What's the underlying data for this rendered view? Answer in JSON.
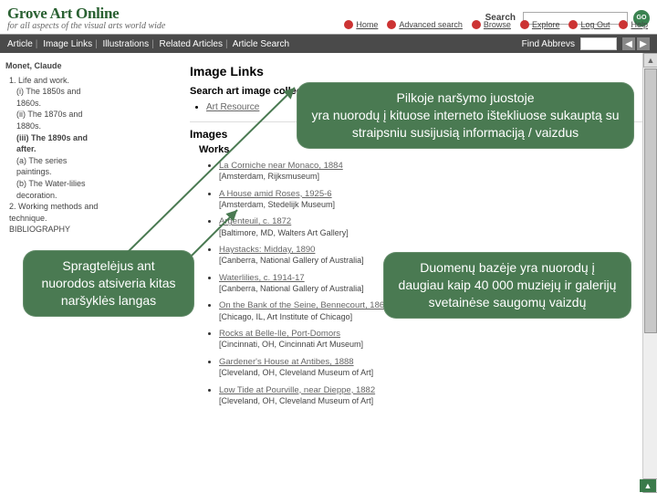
{
  "header": {
    "brand_title": "Grove Art Online",
    "brand_tag": "for all aspects of the visual arts world wide",
    "search_label": "Search",
    "go_label": "GO"
  },
  "navlinks": [
    {
      "label": "Home"
    },
    {
      "label": "Advanced search"
    },
    {
      "label": "Browse"
    },
    {
      "label": "Explore"
    },
    {
      "label": "Log Out"
    },
    {
      "label": "Help"
    }
  ],
  "greybar": {
    "tabs": [
      "Article",
      "Image Links",
      "Illustrations",
      "Related Articles",
      "Article Search"
    ],
    "find_label": "Find Abbrevs"
  },
  "sidebar": {
    "artist": "Monet, Claude",
    "toc": [
      {
        "t": "1. Life and work.",
        "cls": "toc-item"
      },
      {
        "t": "(i) The 1850s and 1860s.",
        "cls": "toc-sub"
      },
      {
        "t": "(ii) The 1870s and 1880s.",
        "cls": "toc-sub"
      },
      {
        "t": "(iii) The 1890s and after.",
        "cls": "toc-sub bold"
      },
      {
        "t": "(a) The series paintings.",
        "cls": "toc-sub"
      },
      {
        "t": "(b) The Water-lilies decoration.",
        "cls": "toc-sub"
      },
      {
        "t": "2. Working methods and technique.",
        "cls": "toc-item"
      },
      {
        "t": "BIBLIOGRAPHY",
        "cls": "toc-item"
      }
    ]
  },
  "content": {
    "h1": "Image Links",
    "subsearch": "Search art image collections",
    "searchlink": "Art Resource",
    "sec_images": "Images",
    "sec_works": "Works",
    "works": [
      {
        "title": "La Corniche near Monaco, 1884",
        "loc": "[Amsterdam, Rijksmuseum]"
      },
      {
        "title": "A House amid Roses, 1925-6",
        "loc": "[Amsterdam, Stedelijk Museum]"
      },
      {
        "title": "Argenteuil, c. 1872",
        "loc": "[Baltimore, MD, Walters Art Gallery]"
      },
      {
        "title": "Haystacks: Midday, 1890",
        "loc": "[Canberra, National Gallery of Australia]"
      },
      {
        "title": "Waterlilies, c. 1914-17",
        "loc": "[Canberra, National Gallery of Australia]"
      },
      {
        "title": "On the Bank of the Seine, Bennecourt, 1868",
        "loc": "[Chicago, IL, Art Institute of Chicago]"
      },
      {
        "title": "Rocks at Belle-Ile, Port-Domors",
        "loc": "[Cincinnati, OH, Cincinnati Art Museum]"
      },
      {
        "title": "Gardener's House at Antibes, 1888",
        "loc": "[Cleveland, OH, Cleveland Museum of Art]"
      },
      {
        "title": "Low Tide at Pourville, near Dieppe, 1882",
        "loc": "[Cleveland, OH, Cleveland Museum of Art]"
      }
    ]
  },
  "callouts": {
    "c1": "Pilkoje naršymo juostoje\nyra nuorodų į kituose interneto ištekliuose sukauptą su straipsniu susijusią informaciją / vaizdus",
    "c2": "Spragtelėjus ant nuorodos atsiveria kitas naršyklės langas",
    "c3": "Duomenų bazėje yra nuorodų į daugiau kaip 40 000 muziejų ir galerijų svetainėse saugomų vaizdų"
  }
}
